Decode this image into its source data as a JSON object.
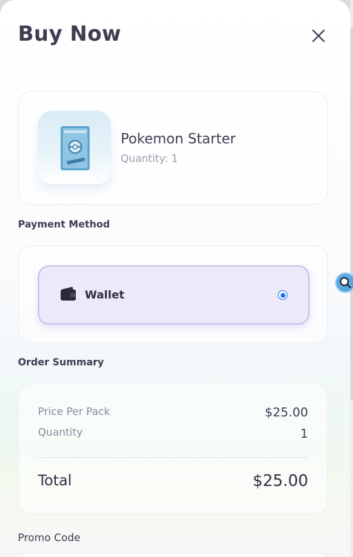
{
  "modal": {
    "title": "Buy Now"
  },
  "product": {
    "name": "Pokemon Starter",
    "quantity_text": "Quantity: 1"
  },
  "payment": {
    "section_label": "Payment Method",
    "options": [
      {
        "label": "Wallet",
        "selected": true
      }
    ]
  },
  "summary": {
    "section_label": "Order Summary",
    "rows": [
      {
        "label": "Price Per Pack",
        "value": "$25.00"
      },
      {
        "label": "Quantity",
        "value": "1"
      }
    ],
    "total_label": "Total",
    "total_value": "$25.00"
  },
  "promo": {
    "label": "Promo Code"
  },
  "colors": {
    "title_text": "#3f3d52",
    "selected_option_bg": "#eceaf9",
    "selected_option_border": "#c3c3ef",
    "radio_accent": "#1a73e8"
  },
  "icons": [
    "close-icon",
    "wallet-icon",
    "radio-selected-icon",
    "search-icon"
  ]
}
